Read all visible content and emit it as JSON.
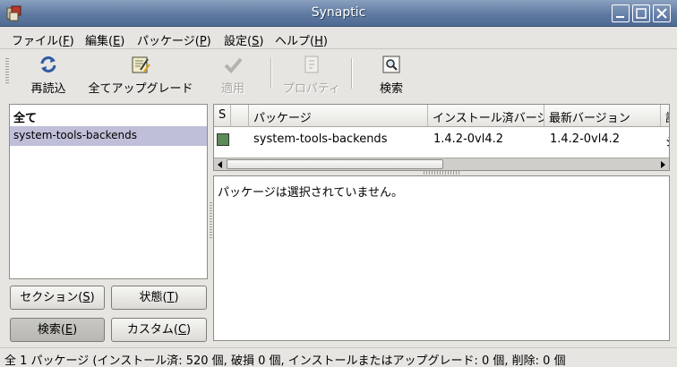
{
  "window": {
    "title": "Synaptic"
  },
  "menu": [
    {
      "label": "ファイル(",
      "key": "F",
      "tail": ")"
    },
    {
      "label": "編集(",
      "key": "E",
      "tail": ")"
    },
    {
      "label": "パッケージ(",
      "key": "P",
      "tail": ")"
    },
    {
      "label": "設定(",
      "key": "S",
      "tail": ")"
    },
    {
      "label": "ヘルプ(",
      "key": "H",
      "tail": ")"
    }
  ],
  "toolbar": {
    "reload": "再読込",
    "upgrade_all": "全てアップグレード",
    "apply": "適用",
    "properties": "プロパティ",
    "search": "検索"
  },
  "filter_list": {
    "header": "全て",
    "items": [
      "system-tools-backends"
    ]
  },
  "filter_buttons": {
    "section": {
      "label": "セクション(",
      "key": "S",
      "tail": ")"
    },
    "status": {
      "label": "状態(",
      "key": "T",
      "tail": ")"
    },
    "search": {
      "label": "検索(",
      "key": "E",
      "tail": ")"
    },
    "custom": {
      "label": "カスタム(",
      "key": "C",
      "tail": ")"
    }
  },
  "package_table": {
    "columns": [
      "S",
      "",
      "パッケージ",
      "インストール済バージ",
      "最新バージョン",
      "説"
    ],
    "rows": [
      {
        "package": "system-tools-backends",
        "installed": "1.4.2-0vl4.2",
        "latest": "1.4.2-0vl4.2",
        "desc": "シ"
      }
    ]
  },
  "description": {
    "text": "パッケージは選択されていません。"
  },
  "status_bar": {
    "text": "全 1 パッケージ (インストール済: 520 個, 破損 0 個, インストールまたはアップグレード: 0 個, 削除: 0 個"
  },
  "colors": {
    "titlebar": "#5f7aa1",
    "selection": "#bfbfd9",
    "status_installed": "#5d8a5a"
  }
}
